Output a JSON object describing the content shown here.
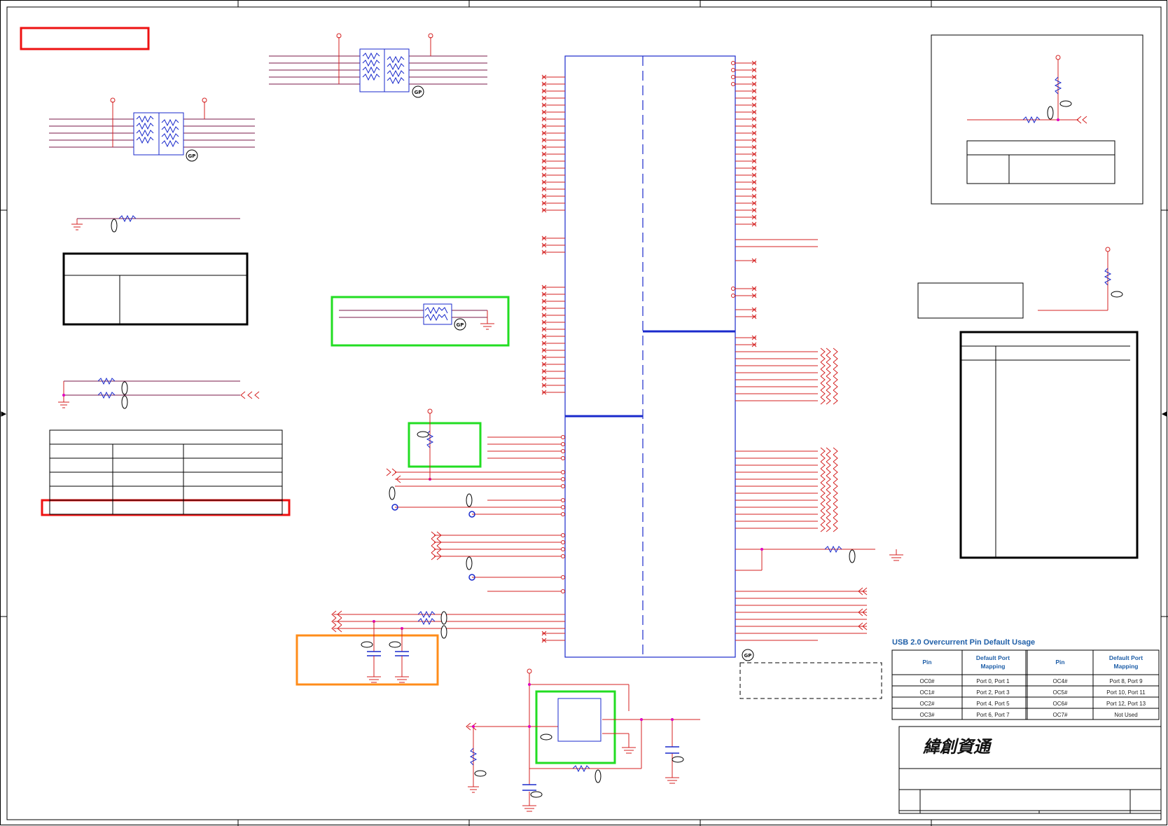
{
  "usb_table": {
    "title": "USB 2.0 Overcurrent Pin Default Usage",
    "headers": [
      "Pin",
      "Default Port Mapping",
      "Pin",
      "Default Port Mapping"
    ],
    "rows": [
      [
        "OC0#",
        "Port 0, Port 1",
        "OC4#",
        "Port 8, Port 9"
      ],
      [
        "OC1#",
        "Port 2, Port 3",
        "OC5#",
        "Port 10, Port 11"
      ],
      [
        "OC2#",
        "Port 4, Port 5",
        "OC6#",
        "Port 12, Port 13"
      ],
      [
        "OC3#",
        "Port 6, Port 7",
        "OC7#",
        "Not Used"
      ]
    ]
  },
  "title_block": {
    "company": "緯創資通"
  },
  "gp_marker": "GP",
  "colors": {
    "wire": "#d42020",
    "net": "#7a1a4a",
    "part": "#1a2acc",
    "junction": "#e000c0",
    "highlight_red": "#ee1111",
    "highlight_green": "#22dd22",
    "highlight_orange": "#ff8c1a",
    "border": "#000000"
  }
}
